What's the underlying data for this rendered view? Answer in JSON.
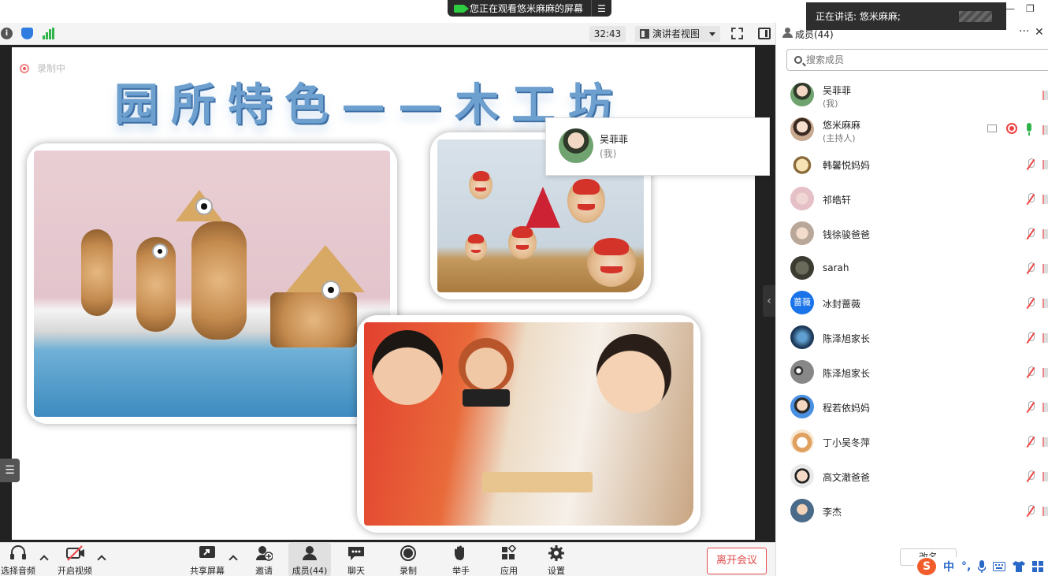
{
  "share_banner": {
    "text": "您正在观看悠米麻麻的屏幕",
    "menu_icon": "menu-icon"
  },
  "speaking": {
    "text": "正在讲话: 悠米麻麻;"
  },
  "window": {
    "minimize": "—",
    "maximize": "❐"
  },
  "meeting_bar": {
    "timer": "32:43",
    "view_mode": "演讲者视图"
  },
  "slide": {
    "recording_label": "录制中",
    "title": "园所特色——木工坊"
  },
  "self_tile": {
    "name": "吴菲菲",
    "sub": "(我)"
  },
  "toolbar": {
    "audio": "选择音频",
    "video": "开启视频",
    "share": "共享屏幕",
    "invite": "邀请",
    "members": "成员(44)",
    "chat": "聊天",
    "record": "录制",
    "raise_hand": "举手",
    "apps": "应用",
    "settings": "设置",
    "leave": "离开会议"
  },
  "panel": {
    "title": "成员(44)",
    "more": "···",
    "close": "✕",
    "search_placeholder": "搜索成员",
    "members": [
      {
        "name": "吴菲菲",
        "sub": "(我)"
      },
      {
        "name": "悠米麻麻",
        "sub": "(主持人)"
      },
      {
        "name": "韩馨悦妈妈"
      },
      {
        "name": "祁皓轩"
      },
      {
        "name": "钱徐骏爸爸"
      },
      {
        "name": "sarah"
      },
      {
        "name": "冰封蔷薇",
        "avatar_text": "蔷薇"
      },
      {
        "name": "陈泽旭家长"
      },
      {
        "name": "陈泽旭家长"
      },
      {
        "name": "程若依妈妈"
      },
      {
        "name": "丁小吴冬萍"
      },
      {
        "name": "高文澈爸爸"
      },
      {
        "name": "李杰"
      }
    ],
    "footer_button": "改名"
  },
  "ime": {
    "logo": "S",
    "lang": "中",
    "punct": "°,"
  },
  "colors": {
    "accent_blue": "#2f7de1",
    "leave_red": "#e04a4a",
    "mic_green": "#2fb34a",
    "title_blue": "#6ea0cf"
  }
}
